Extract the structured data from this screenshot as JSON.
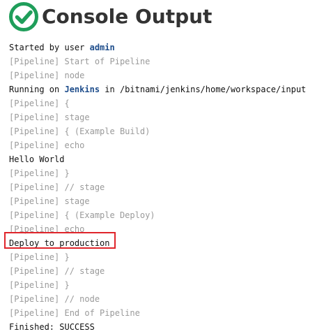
{
  "header": {
    "title": "Console Output",
    "status_icon": "success-check-icon",
    "status_color": "#1f9e5a"
  },
  "console": {
    "lines": [
      {
        "type": "text",
        "prefix": "Started by user ",
        "link": "admin",
        "suffix": ""
      },
      {
        "type": "pipeline",
        "text": "[Pipeline] Start of Pipeline"
      },
      {
        "type": "pipeline",
        "text": "[Pipeline] node"
      },
      {
        "type": "text",
        "prefix": "Running on ",
        "link": "Jenkins",
        "suffix": " in /bitnami/jenkins/home/workspace/input"
      },
      {
        "type": "pipeline",
        "text": "[Pipeline] {"
      },
      {
        "type": "pipeline",
        "text": "[Pipeline] stage"
      },
      {
        "type": "pipeline",
        "text": "[Pipeline] { (Example Build)"
      },
      {
        "type": "pipeline",
        "text": "[Pipeline] echo"
      },
      {
        "type": "text",
        "text": "Hello World"
      },
      {
        "type": "pipeline",
        "text": "[Pipeline] }"
      },
      {
        "type": "pipeline",
        "text": "[Pipeline] // stage"
      },
      {
        "type": "pipeline",
        "text": "[Pipeline] stage"
      },
      {
        "type": "pipeline",
        "text": "[Pipeline] { (Example Deploy)"
      },
      {
        "type": "pipeline",
        "text": "[Pipeline] echo"
      },
      {
        "type": "text",
        "text": "Deploy to production",
        "highlighted": true
      },
      {
        "type": "pipeline",
        "text": "[Pipeline] }"
      },
      {
        "type": "pipeline",
        "text": "[Pipeline] // stage"
      },
      {
        "type": "pipeline",
        "text": "[Pipeline] }"
      },
      {
        "type": "pipeline",
        "text": "[Pipeline] // node"
      },
      {
        "type": "pipeline",
        "text": "[Pipeline] End of Pipeline"
      },
      {
        "type": "text",
        "text": "Finished: SUCCESS"
      }
    ]
  },
  "annotation": {
    "color": "#e0252b"
  }
}
